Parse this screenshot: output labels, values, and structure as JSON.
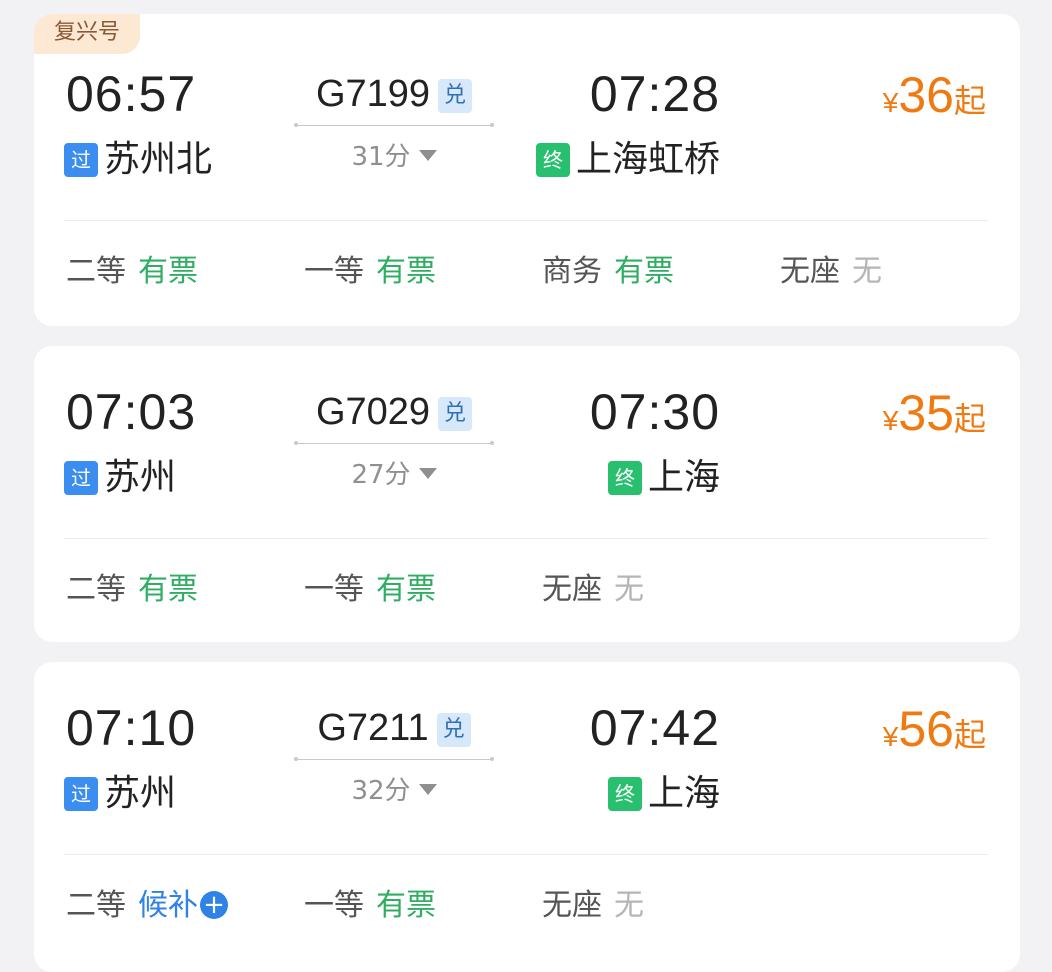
{
  "trains": [
    {
      "tag": "复兴号",
      "dep_time": "06:57",
      "train_no": "G7199",
      "dui": "兑",
      "arr_time": "07:28",
      "duration": "31分",
      "dep_badge": "过",
      "dep_station": "苏州北",
      "arr_badge": "终",
      "arr_station": "上海虹桥",
      "price": {
        "yen": "¥",
        "amount": "36",
        "suffix": "起"
      },
      "seats": [
        {
          "class": "二等",
          "status": "有票",
          "kind": "ok"
        },
        {
          "class": "一等",
          "status": "有票",
          "kind": "ok"
        },
        {
          "class": "商务",
          "status": "有票",
          "kind": "ok"
        },
        {
          "class": "无座",
          "status": "无",
          "kind": "no"
        }
      ]
    },
    {
      "tag": "",
      "dep_time": "07:03",
      "train_no": "G7029",
      "dui": "兑",
      "arr_time": "07:30",
      "duration": "27分",
      "dep_badge": "过",
      "dep_station": "苏州",
      "arr_badge": "终",
      "arr_station": "上海",
      "price": {
        "yen": "¥",
        "amount": "35",
        "suffix": "起"
      },
      "seats": [
        {
          "class": "二等",
          "status": "有票",
          "kind": "ok"
        },
        {
          "class": "一等",
          "status": "有票",
          "kind": "ok"
        },
        {
          "class": "无座",
          "status": "无",
          "kind": "no"
        }
      ]
    },
    {
      "tag": "",
      "dep_time": "07:10",
      "train_no": "G7211",
      "dui": "兑",
      "arr_time": "07:42",
      "duration": "32分",
      "dep_badge": "过",
      "dep_station": "苏州",
      "arr_badge": "终",
      "arr_station": "上海",
      "price": {
        "yen": "¥",
        "amount": "56",
        "suffix": "起"
      },
      "seats": [
        {
          "class": "二等",
          "status": "候补",
          "kind": "wait"
        },
        {
          "class": "一等",
          "status": "有票",
          "kind": "ok"
        },
        {
          "class": "无座",
          "status": "无",
          "kind": "no"
        }
      ]
    }
  ],
  "colors": {
    "price": "#f07a12",
    "available": "#2fae63",
    "unavailable": "#b5b5b5",
    "waitlist": "#2f82e6",
    "pass_badge": "#3b8ef0",
    "end_badge": "#28c06e",
    "tag_bg": "#fde8d3"
  },
  "icons": {
    "duration_toggle": "caret-down-icon",
    "waitlist_add": "plus-circle-icon"
  }
}
